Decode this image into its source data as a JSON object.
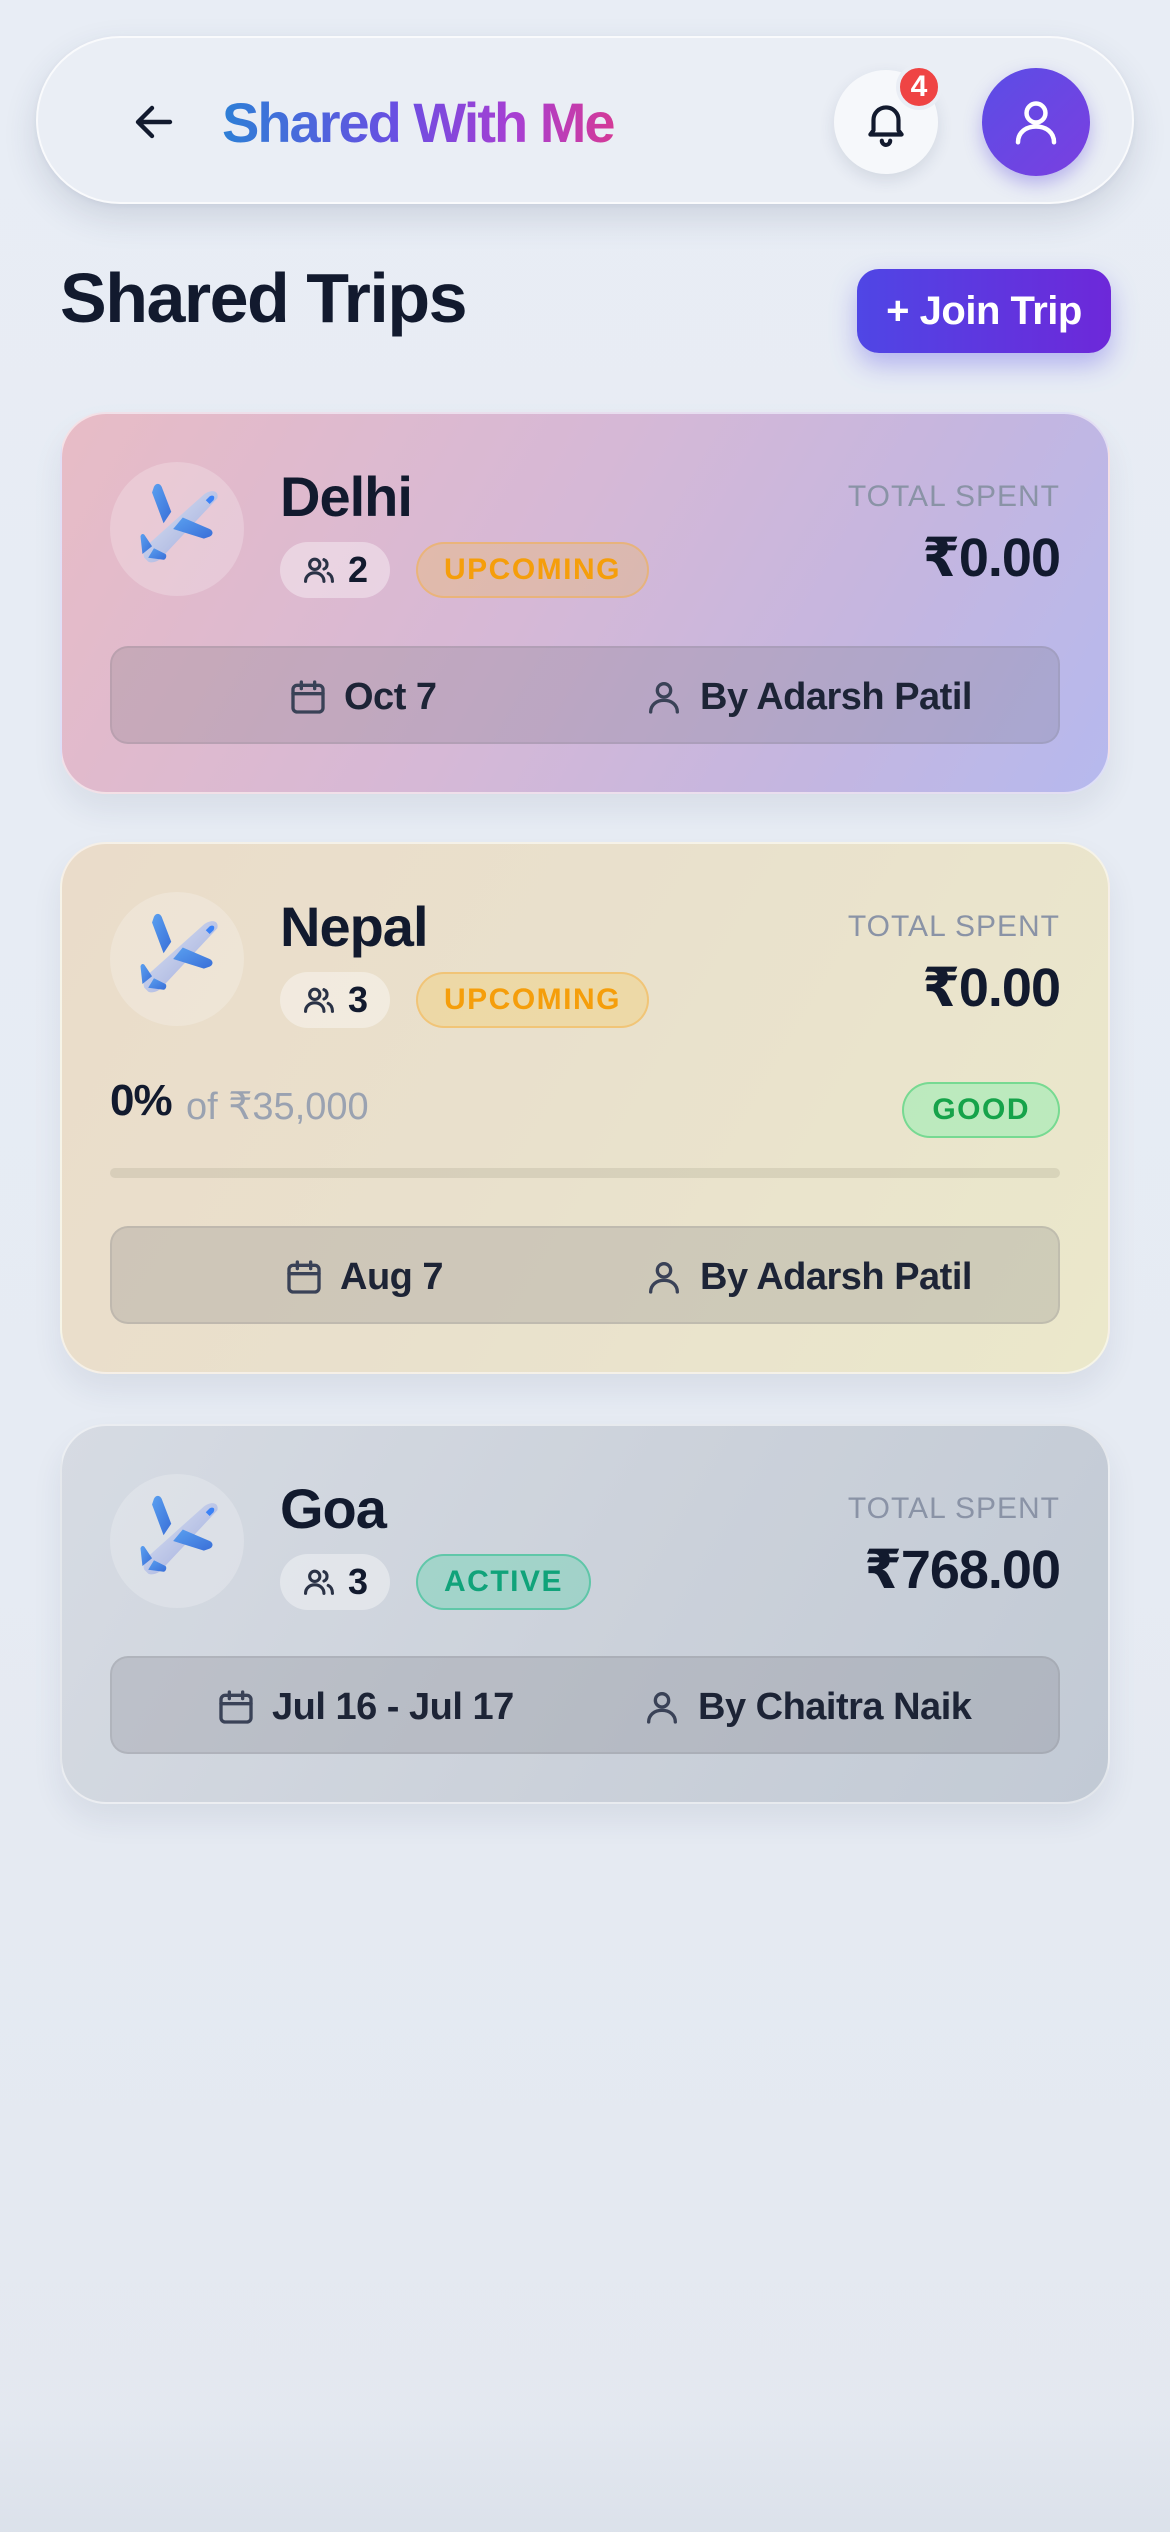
{
  "header": {
    "title": "Shared With Me",
    "notification_count": "4",
    "icons": {
      "back": "arrow-left-icon",
      "bell": "bell-icon",
      "profile": "user-icon"
    }
  },
  "section": {
    "title": "Shared Trips",
    "join_label": "+ Join Trip"
  },
  "trips": [
    {
      "name": "Delhi",
      "members": "2",
      "status": "UPCOMING",
      "spent_label": "TOTAL SPENT",
      "spent": "₹0.00",
      "date": "Oct 7",
      "owner": "By Adarsh Patil",
      "icon": "airplane-icon"
    },
    {
      "name": "Nepal",
      "members": "3",
      "status": "UPCOMING",
      "spent_label": "TOTAL SPENT",
      "spent": "₹0.00",
      "budget": {
        "percent": "0%",
        "of_text": "of ₹35,000",
        "health": "GOOD",
        "progress": 0
      },
      "date": "Aug 7",
      "owner": "By Adarsh Patil",
      "icon": "airplane-icon"
    },
    {
      "name": "Goa",
      "members": "3",
      "status": "ACTIVE",
      "spent_label": "TOTAL SPENT",
      "spent": "₹768.00",
      "date": "Jul 16 - Jul 17",
      "owner": "By Chaitra Naik",
      "icon": "airplane-icon"
    }
  ],
  "colors": {
    "accent": "#4f46e5",
    "upcoming": "#f59e0b",
    "active": "#10a37a",
    "good": "#16a34a",
    "badge_red": "#ef4444"
  }
}
